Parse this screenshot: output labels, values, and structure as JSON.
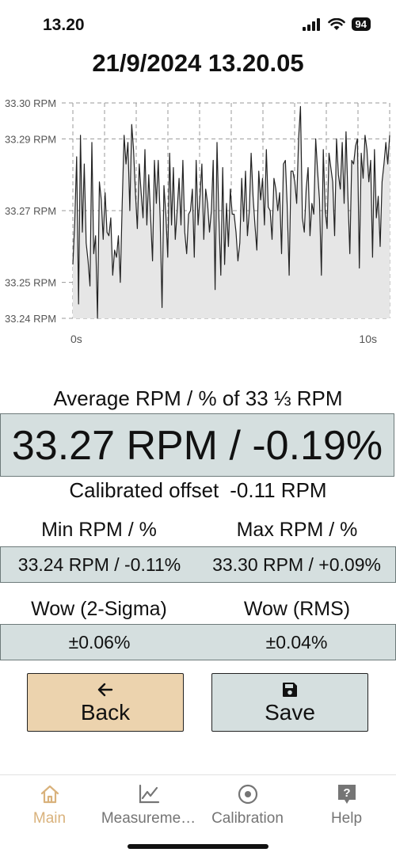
{
  "status": {
    "time": "13.20",
    "battery": "94"
  },
  "header": {
    "timestamp": "21/9/2024 13.20.05"
  },
  "chart_data": {
    "type": "line",
    "title": "",
    "xlabel": "",
    "ylabel": "",
    "x_ticks": [
      "0s",
      "10s"
    ],
    "y_ticks": [
      "33.30 RPM",
      "33.29 RPM",
      "33.27 RPM",
      "33.25 RPM",
      "33.24 RPM"
    ],
    "ylim": [
      33.24,
      33.3
    ],
    "xlim": [
      0,
      10
    ],
    "grid": true,
    "fill": "#e6e6e6",
    "line_color": "#222222",
    "series": [
      {
        "values": [
          33.255,
          33.267,
          33.285,
          33.244,
          33.291,
          33.264,
          33.283,
          33.261,
          33.256,
          33.249,
          33.289,
          33.258,
          33.263,
          33.24,
          33.278,
          33.273,
          33.262,
          33.275,
          33.264,
          33.263,
          33.268,
          33.252,
          33.259,
          33.257,
          33.263,
          33.25,
          33.272,
          33.291,
          33.283,
          33.289,
          33.27,
          33.294,
          33.287,
          33.275,
          33.265,
          33.283,
          33.275,
          33.268,
          33.287,
          33.266,
          33.28,
          33.268,
          33.256,
          33.284,
          33.272,
          33.284,
          33.268,
          33.243,
          33.277,
          33.269,
          33.257,
          33.286,
          33.266,
          33.282,
          33.262,
          33.27,
          33.279,
          33.266,
          33.284,
          33.264,
          33.258,
          33.269,
          33.27,
          33.276,
          33.257,
          33.284,
          33.266,
          33.274,
          33.283,
          33.262,
          33.276,
          33.272,
          33.264,
          33.27,
          33.284,
          33.248,
          33.289,
          33.268,
          33.252,
          33.282,
          33.255,
          33.272,
          33.26,
          33.276,
          33.269,
          33.269,
          33.264,
          33.256,
          33.261,
          33.279,
          33.267,
          33.281,
          33.263,
          33.27,
          33.286,
          33.274,
          33.266,
          33.259,
          33.281,
          33.273,
          33.279,
          33.266,
          33.287,
          33.271,
          33.27,
          33.262,
          33.279,
          33.276,
          33.27,
          33.275,
          33.258,
          33.283,
          33.284,
          33.271,
          33.252,
          33.281,
          33.281,
          33.278,
          33.272,
          33.29,
          33.299,
          33.268,
          33.264,
          33.276,
          33.282,
          33.263,
          33.272,
          33.269,
          33.29,
          33.281,
          33.273,
          33.252,
          33.287,
          33.27,
          33.265,
          33.286,
          33.282,
          33.278,
          33.263,
          33.29,
          33.28,
          33.276,
          33.289,
          33.272,
          33.292,
          33.274,
          33.258,
          33.284,
          33.283,
          33.288,
          33.29,
          33.254,
          33.286,
          33.279,
          33.291,
          33.287,
          33.278,
          33.284,
          33.257,
          33.287,
          33.268,
          33.274,
          33.26,
          33.278,
          33.283,
          33.289,
          33.283,
          33.291
        ]
      }
    ]
  },
  "stats": {
    "avg_label": "Average RPM / % of 33 ⅓ RPM",
    "avg_value": "33.27 RPM / -0.19%",
    "offset_label": "Calibrated offset",
    "offset_value": "-0.11 RPM",
    "min_label": "Min RPM / %",
    "max_label": "Max RPM / %",
    "min_value": "33.24 RPM / -0.11%",
    "max_value": "33.30 RPM / +0.09%",
    "wow2_label": "Wow (2-Sigma)",
    "wowrms_label": "Wow (RMS)",
    "wow2_value": "±0.06%",
    "wowrms_value": "±0.04%"
  },
  "actions": {
    "back_label": "Back",
    "save_label": "Save"
  },
  "tabs": [
    {
      "label": "Main",
      "icon": "home-icon",
      "active": true
    },
    {
      "label": "Measureme…",
      "icon": "chart-icon",
      "active": false
    },
    {
      "label": "Calibration",
      "icon": "target-icon",
      "active": false
    },
    {
      "label": "Help",
      "icon": "question-icon",
      "active": false
    }
  ],
  "colors": {
    "accent": "#d9b27c",
    "panel": "#d5dfdf",
    "back_button": "#ecd3ae"
  }
}
